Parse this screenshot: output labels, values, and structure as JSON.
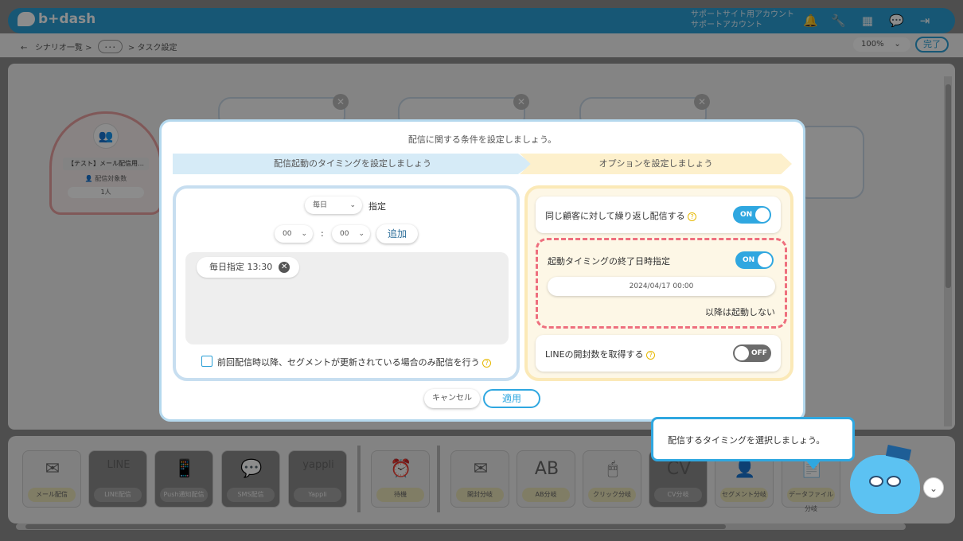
{
  "app": {
    "logo_text": "b+dash"
  },
  "header": {
    "account_line1": "サポートサイト用アカウント",
    "account_line2": "サポートアカウント",
    "icons": [
      "bell-icon",
      "wrench-icon",
      "grid-icon",
      "chat-icon",
      "logout-icon"
    ]
  },
  "breadcrumb": {
    "back": "←",
    "scenario_list": "シナリオ一覧",
    "sep": ">",
    "ellipsis": "･･･",
    "current": "タスク設定"
  },
  "toolbar": {
    "zoom": "100%",
    "zoom_caret": "⌄",
    "done_label": "完了"
  },
  "canvas": {
    "start_node": {
      "title": "【テスト】メール配信用…",
      "target_label": "配信対象数",
      "target_count": "1人"
    }
  },
  "modal": {
    "title": "配信に関する条件を設定しましょう。",
    "step1_label": "配信起動のタイミングを設定しましょう",
    "step2_label": "オプションを設定しましょう",
    "left": {
      "frequency_value": "毎日",
      "frequency_suffix": "指定",
      "hour_value": "00",
      "minute_value": "00",
      "time_sep": ":",
      "add_label": "追加",
      "tags": [
        "毎日指定 13:30"
      ],
      "checkbox_label": "前回配信時以降、セグメントが更新されている場合のみ配信を行う"
    },
    "right": {
      "opt1_label": "同じ顧客に対して繰り返し配信する",
      "opt1_state": "ON",
      "opt2_label": "起動タイミングの終了日時指定",
      "opt2_state": "ON",
      "opt2_date": "2024/04/17 00:00",
      "opt2_note": "以降は起動しない",
      "opt3_label": "LINEの開封数を取得する",
      "opt3_state": "OFF"
    },
    "cancel_label": "キャンセル",
    "apply_label": "適用"
  },
  "palette": {
    "items": [
      {
        "label": "メール配信",
        "icon": "mail-icon",
        "glyph": "✉"
      },
      {
        "label": "LINE配信",
        "icon": "line-icon",
        "glyph": "LINE"
      },
      {
        "label": "Push通知配信",
        "icon": "push-icon",
        "glyph": "📱"
      },
      {
        "label": "SMS配信",
        "icon": "sms-icon",
        "glyph": "💬"
      },
      {
        "label": "Yappli",
        "icon": "yappli-icon",
        "glyph": "yappli"
      },
      {
        "label": "待機",
        "icon": "clock-icon",
        "glyph": "⏰"
      },
      {
        "label": "開封分岐",
        "icon": "open-mail-icon",
        "glyph": "✉"
      },
      {
        "label": "AB分岐",
        "icon": "ab-icon",
        "glyph": "AB"
      },
      {
        "label": "クリック分岐",
        "icon": "mouse-icon",
        "glyph": "🖱"
      },
      {
        "label": "CV分岐",
        "icon": "cv-icon",
        "glyph": "CV"
      },
      {
        "label": "セグメント分岐",
        "icon": "segment-icon",
        "glyph": "👤"
      },
      {
        "label": "データファイル分岐",
        "icon": "data-file-icon",
        "glyph": "📄"
      }
    ]
  },
  "tooltip": {
    "text": "配信するタイミングを選択しましょう。"
  },
  "colors": {
    "accent": "#2fa7e0",
    "highlight": "#ee6f7e",
    "option_bg": "#fdf7e6"
  }
}
